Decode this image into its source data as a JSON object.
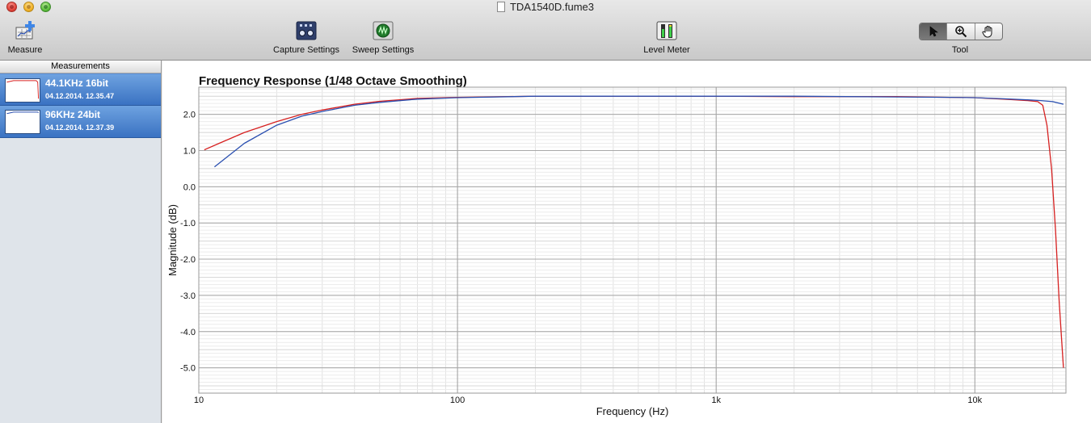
{
  "window": {
    "title": "TDA1540D.fume3"
  },
  "toolbar": {
    "measure_label": "Measure",
    "capture_settings_label": "Capture Settings",
    "sweep_settings_label": "Sweep Settings",
    "level_meter_label": "Level Meter",
    "tool_label": "Tool",
    "tools": [
      "pointer-icon",
      "zoom-icon",
      "hand-icon"
    ],
    "active_tool": "pointer"
  },
  "sidebar": {
    "header": "Measurements",
    "items": [
      {
        "name": "44.1KHz 16bit",
        "date": "04.12.2014. 12.35.47",
        "color": "#d62020"
      },
      {
        "name": "96KHz 24bit",
        "date": "04.12.2014. 12.37.39",
        "color": "#2a4fb0"
      }
    ]
  },
  "chart_data": {
    "type": "line",
    "title": "Frequency Response (1/48 Octave Smoothing)",
    "xlabel": "Frequency (Hz)",
    "ylabel": "Magnitude (dB)",
    "xscale": "log",
    "xlim": [
      10,
      22500
    ],
    "ylim": [
      -5.7,
      2.75
    ],
    "x_ticks": [
      10,
      100,
      1000,
      10000
    ],
    "x_tick_labels": [
      "10",
      "100",
      "1k",
      "10k"
    ],
    "y_ticks": [
      2.0,
      1.0,
      0.0,
      -1.0,
      -2.0,
      -3.0,
      -4.0,
      -5.0
    ],
    "y_tick_labels": [
      "2.0",
      "1.0",
      "0.0",
      "-1.0",
      "-2.0",
      "-3.0",
      "-4.0",
      "-5.0"
    ],
    "grid": true,
    "series": [
      {
        "name": "44.1KHz 16bit",
        "color": "#d62020",
        "x": [
          10.5,
          12,
          15,
          20,
          25,
          30,
          40,
          50,
          70,
          100,
          200,
          500,
          1000,
          2000,
          5000,
          8000,
          10000,
          13000,
          16000,
          17500,
          18300,
          19000,
          19800,
          20500,
          21200,
          22000
        ],
        "y": [
          1.02,
          1.2,
          1.5,
          1.8,
          2.0,
          2.12,
          2.28,
          2.36,
          2.44,
          2.47,
          2.5,
          2.5,
          2.5,
          2.49,
          2.49,
          2.47,
          2.46,
          2.42,
          2.38,
          2.35,
          2.25,
          1.7,
          0.5,
          -1.2,
          -3.2,
          -5.0
        ]
      },
      {
        "name": "96KHz 24bit",
        "color": "#2a4fb0",
        "x": [
          11.5,
          15,
          20,
          25,
          30,
          40,
          50,
          70,
          100,
          200,
          500,
          1000,
          2000,
          5000,
          8000,
          10000,
          13000,
          16000,
          18000,
          20000,
          22000
        ],
        "y": [
          0.55,
          1.2,
          1.7,
          1.95,
          2.08,
          2.25,
          2.33,
          2.42,
          2.46,
          2.5,
          2.5,
          2.5,
          2.5,
          2.48,
          2.47,
          2.46,
          2.43,
          2.4,
          2.38,
          2.35,
          2.28
        ]
      }
    ]
  }
}
